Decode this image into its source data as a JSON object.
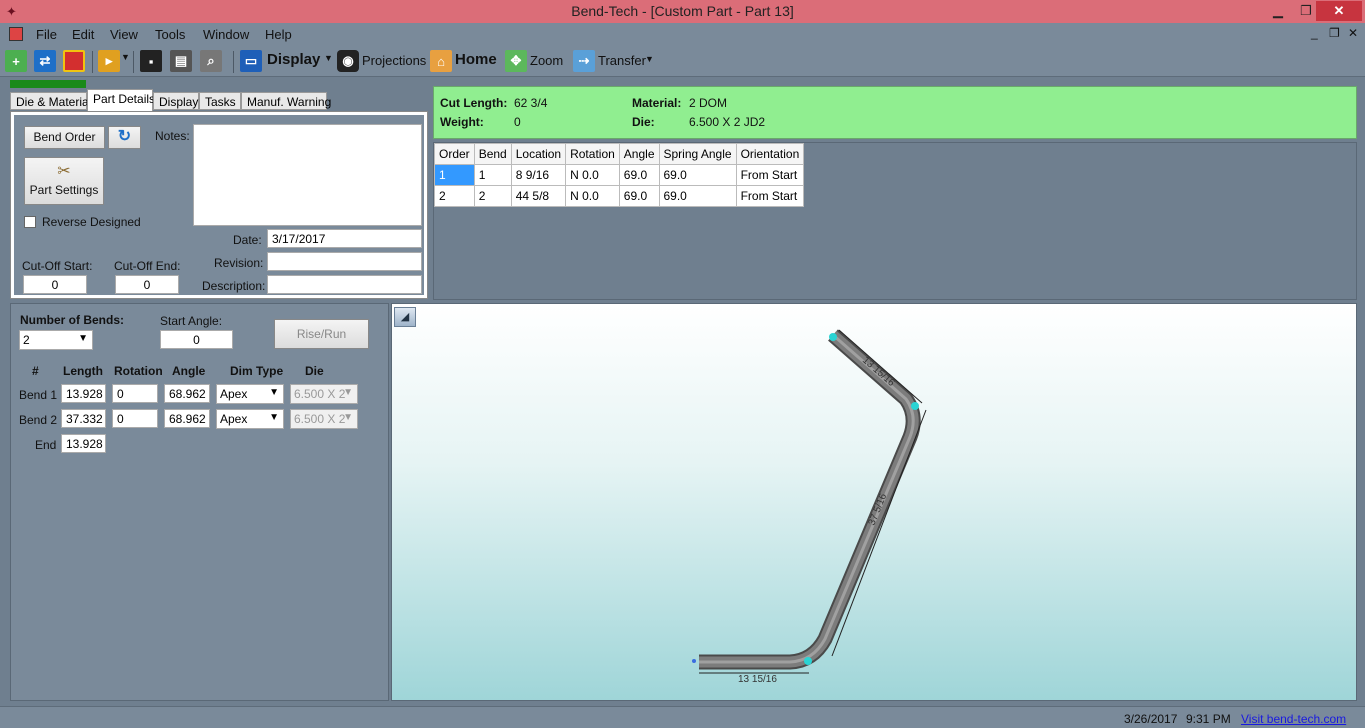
{
  "window": {
    "title": "Bend-Tech - [Custom Part - Part 13]",
    "minimize": "▁",
    "restore": "❐",
    "close": "✕"
  },
  "menu": {
    "items": [
      "File",
      "Edit",
      "View",
      "Tools",
      "Window",
      "Help"
    ],
    "mdi_min": "_",
    "mdi_restore": "❐",
    "mdi_close": "✕"
  },
  "toolbar": {
    "display_label": "Display",
    "projections_label": "Projections",
    "home_label": "Home",
    "zoom_label": "Zoom",
    "transfer_label": "Transfer"
  },
  "tabs": [
    "Die & Material",
    "Part Details",
    "Display",
    "Tasks",
    "Manuf. Warning"
  ],
  "part_details": {
    "bend_order_label": "Bend Order",
    "part_settings_label": "Part Settings",
    "notes_label": "Notes:",
    "notes_value": "",
    "reverse_designed_label": "Reverse Designed",
    "date_label": "Date:",
    "date_value": "3/17/2017",
    "revision_label": "Revision:",
    "revision_value": "",
    "description_label": "Description:",
    "description_value": "",
    "cutoff_start_label": "Cut-Off Start:",
    "cutoff_start_value": "0",
    "cutoff_end_label": "Cut-Off End:",
    "cutoff_end_value": "0"
  },
  "info": {
    "cut_length_label": "Cut Length:",
    "cut_length_value": "62 3/4",
    "weight_label": "Weight:",
    "weight_value": "0",
    "material_label": "Material:",
    "material_value": "2 DOM",
    "die_label": "Die:",
    "die_value": "6.500 X 2 JD2"
  },
  "bend_table": {
    "columns": [
      "Order",
      "Bend",
      "Location",
      "Rotation",
      "Angle",
      "Spring Angle",
      "Orientation"
    ],
    "rows": [
      [
        "1",
        "1",
        "8 9/16",
        "N  0.0",
        "69.0",
        "69.0",
        "From Start"
      ],
      [
        "2",
        "2",
        "44 5/8",
        "N  0.0",
        "69.0",
        "69.0",
        "From Start"
      ]
    ]
  },
  "bends": {
    "number_of_bends_label": "Number of Bends:",
    "number_of_bends_value": "2",
    "start_angle_label": "Start Angle:",
    "start_angle_value": "0",
    "rise_run_label": "Rise/Run",
    "headers": [
      "#",
      "Length",
      "Rotation",
      "Angle",
      "Dim Type",
      "Die"
    ],
    "rows": [
      {
        "name": "Bend 1",
        "length": "13.928",
        "rotation": "0",
        "angle": "68.962",
        "dim_type": "Apex",
        "die": "6.500 X 2"
      },
      {
        "name": "Bend 2",
        "length": "37.332",
        "rotation": "0",
        "angle": "68.962",
        "dim_type": "Apex",
        "die": "6.500 X 2"
      }
    ],
    "end_label": "End",
    "end_value": "13.928"
  },
  "viewport": {
    "dim_top": "13 15/16",
    "dim_middle": "37 5/16",
    "dim_bottom": "13 15/16"
  },
  "status": {
    "date": "3/26/2017",
    "time": "9:31 PM",
    "link": "Visit bend-tech.com"
  },
  "colors": {
    "titlebar": "#db6d78",
    "chrome": "#7a8a9a",
    "info_green": "#90ee90",
    "selection": "#3399ff",
    "tube": "#707070"
  }
}
